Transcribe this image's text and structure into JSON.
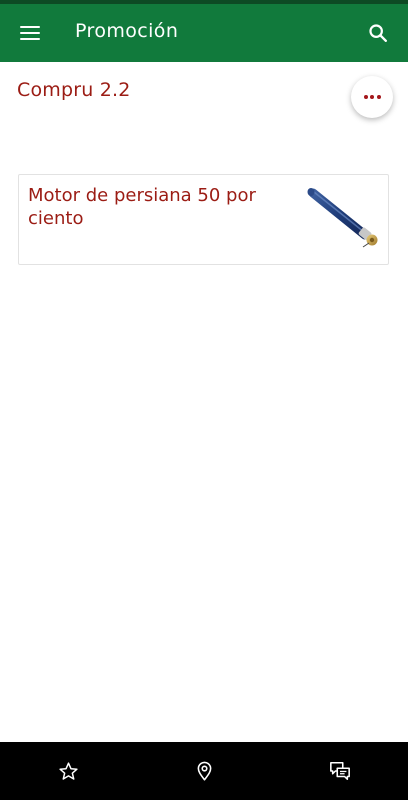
{
  "app_bar": {
    "title": "Promoción",
    "menu_icon": "hamburger-menu-icon",
    "search_icon": "search-icon",
    "color": "#117a3c"
  },
  "section": {
    "title": "Compru 2.2",
    "more_icon": "more-horizontal-icon"
  },
  "card": {
    "title": "Motor de persiana 50 por ciento",
    "image": "tubular-motor-image"
  },
  "bottom_nav": {
    "items": [
      {
        "icon": "star-icon"
      },
      {
        "icon": "location-pin-icon"
      },
      {
        "icon": "chat-bubbles-icon"
      }
    ]
  },
  "colors": {
    "accent": "#9b1c14",
    "app_bar": "#117a3c",
    "bottom_bar": "#000000"
  }
}
